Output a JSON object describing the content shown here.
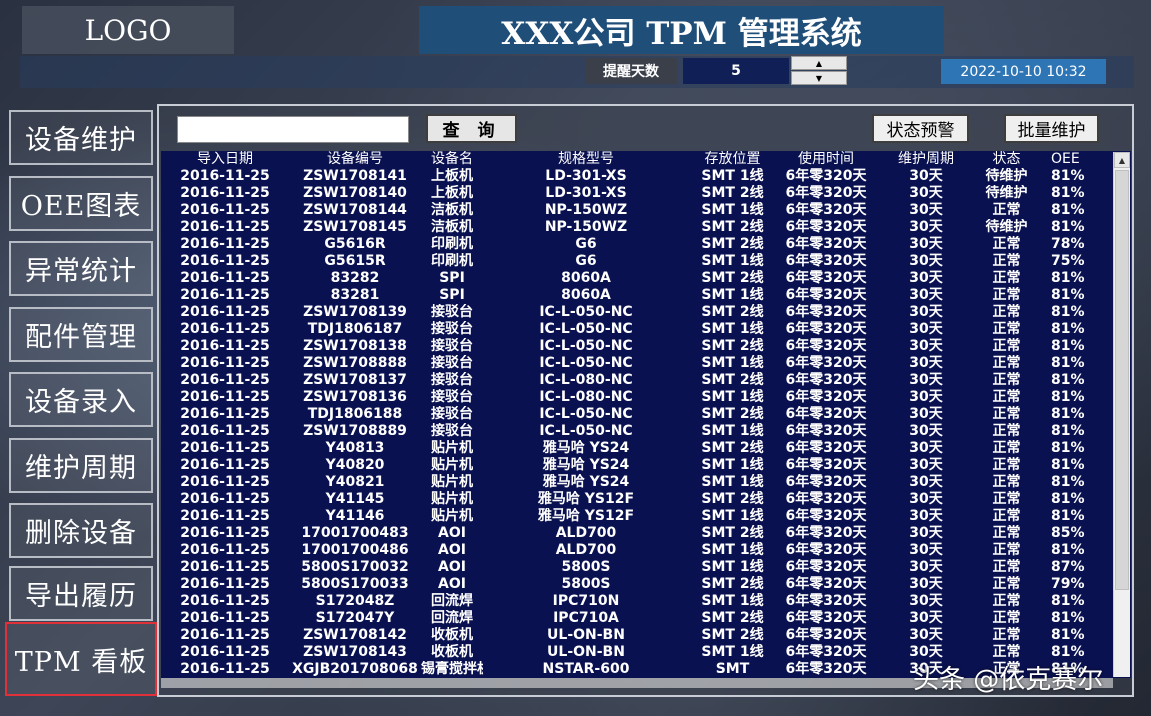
{
  "header": {
    "logo": "LOGO",
    "title": "XXX公司 TPM 管理系统",
    "remind_label": "提醒天数",
    "remind_value": "5",
    "datetime": "2022-10-10 10:32"
  },
  "sidebar": {
    "items": [
      {
        "label": "设备维护"
      },
      {
        "label": "OEE图表"
      },
      {
        "label": "异常统计"
      },
      {
        "label": "配件管理"
      },
      {
        "label": "设备录入"
      },
      {
        "label": "维护周期"
      },
      {
        "label": "删除设备"
      },
      {
        "label": "导出履历"
      },
      {
        "label": "TPM 看板"
      }
    ],
    "active_index": 8
  },
  "toolbar": {
    "search_value": "",
    "query_label": "查 询",
    "status_alert_label": "状态预警",
    "batch_maint_label": "批量维护"
  },
  "table": {
    "columns": [
      "导入日期",
      "设备编号",
      "设备名",
      "规格型号",
      "存放位置",
      "使用时间",
      "维护周期",
      "状态",
      "OEE"
    ],
    "rows": [
      [
        "2016-11-25",
        "ZSW1708141",
        "上板机",
        "LD-301-XS",
        "SMT 1线",
        "6年零320天",
        "30天",
        "待维护",
        "81%"
      ],
      [
        "2016-11-25",
        "ZSW1708140",
        "上板机",
        "LD-301-XS",
        "SMT 2线",
        "6年零320天",
        "30天",
        "待维护",
        "81%"
      ],
      [
        "2016-11-25",
        "ZSW1708144",
        "洁板机",
        "NP-150WZ",
        "SMT 1线",
        "6年零320天",
        "30天",
        "正常",
        "81%"
      ],
      [
        "2016-11-25",
        "ZSW1708145",
        "洁板机",
        "NP-150WZ",
        "SMT 2线",
        "6年零320天",
        "30天",
        "待维护",
        "81%"
      ],
      [
        "2016-11-25",
        "G5616R",
        "印刷机",
        "G6",
        "SMT 2线",
        "6年零320天",
        "30天",
        "正常",
        "78%"
      ],
      [
        "2016-11-25",
        "G5615R",
        "印刷机",
        "G6",
        "SMT 1线",
        "6年零320天",
        "30天",
        "正常",
        "75%"
      ],
      [
        "2016-11-25",
        "83282",
        "SPI",
        "8060A",
        "SMT 2线",
        "6年零320天",
        "30天",
        "正常",
        "81%"
      ],
      [
        "2016-11-25",
        "83281",
        "SPI",
        "8060A",
        "SMT 1线",
        "6年零320天",
        "30天",
        "正常",
        "81%"
      ],
      [
        "2016-11-25",
        "ZSW1708139",
        "接驳台",
        "IC-L-050-NC",
        "SMT 2线",
        "6年零320天",
        "30天",
        "正常",
        "81%"
      ],
      [
        "2016-11-25",
        "TDJ1806187",
        "接驳台",
        "IC-L-050-NC",
        "SMT 1线",
        "6年零320天",
        "30天",
        "正常",
        "81%"
      ],
      [
        "2016-11-25",
        "ZSW1708138",
        "接驳台",
        "IC-L-050-NC",
        "SMT 2线",
        "6年零320天",
        "30天",
        "正常",
        "81%"
      ],
      [
        "2016-11-25",
        "ZSW1708888",
        "接驳台",
        "IC-L-050-NC",
        "SMT 1线",
        "6年零320天",
        "30天",
        "正常",
        "81%"
      ],
      [
        "2016-11-25",
        "ZSW1708137",
        "接驳台",
        "IC-L-080-NC",
        "SMT 2线",
        "6年零320天",
        "30天",
        "正常",
        "81%"
      ],
      [
        "2016-11-25",
        "ZSW1708136",
        "接驳台",
        "IC-L-080-NC",
        "SMT 1线",
        "6年零320天",
        "30天",
        "正常",
        "81%"
      ],
      [
        "2016-11-25",
        "TDJ1806188",
        "接驳台",
        "IC-L-050-NC",
        "SMT 2线",
        "6年零320天",
        "30天",
        "正常",
        "81%"
      ],
      [
        "2016-11-25",
        "ZSW1708889",
        "接驳台",
        "IC-L-050-NC",
        "SMT 1线",
        "6年零320天",
        "30天",
        "正常",
        "81%"
      ],
      [
        "2016-11-25",
        "Y40813",
        "贴片机",
        "雅马哈 YS24",
        "SMT 2线",
        "6年零320天",
        "30天",
        "正常",
        "81%"
      ],
      [
        "2016-11-25",
        "Y40820",
        "贴片机",
        "雅马哈 YS24",
        "SMT 1线",
        "6年零320天",
        "30天",
        "正常",
        "81%"
      ],
      [
        "2016-11-25",
        "Y40821",
        "贴片机",
        "雅马哈 YS24",
        "SMT 1线",
        "6年零320天",
        "30天",
        "正常",
        "81%"
      ],
      [
        "2016-11-25",
        "Y41145",
        "贴片机",
        "雅马哈 YS12F",
        "SMT 2线",
        "6年零320天",
        "30天",
        "正常",
        "81%"
      ],
      [
        "2016-11-25",
        "Y41146",
        "贴片机",
        "雅马哈 YS12F",
        "SMT 1线",
        "6年零320天",
        "30天",
        "正常",
        "81%"
      ],
      [
        "2016-11-25",
        "17001700483",
        "AOI",
        "ALD700",
        "SMT 2线",
        "6年零320天",
        "30天",
        "正常",
        "85%"
      ],
      [
        "2016-11-25",
        "17001700486",
        "AOI",
        "ALD700",
        "SMT 1线",
        "6年零320天",
        "30天",
        "正常",
        "81%"
      ],
      [
        "2016-11-25",
        "5800S170032",
        "AOI",
        "5800S",
        "SMT 1线",
        "6年零320天",
        "30天",
        "正常",
        "87%"
      ],
      [
        "2016-11-25",
        "5800S170033",
        "AOI",
        "5800S",
        "SMT 2线",
        "6年零320天",
        "30天",
        "正常",
        "79%"
      ],
      [
        "2016-11-25",
        "S172048Z",
        "回流焊",
        "IPC710N",
        "SMT 1线",
        "6年零320天",
        "30天",
        "正常",
        "81%"
      ],
      [
        "2016-11-25",
        "S172047Y",
        "回流焊",
        "IPC710A",
        "SMT 2线",
        "6年零320天",
        "30天",
        "正常",
        "81%"
      ],
      [
        "2016-11-25",
        "ZSW1708142",
        "收板机",
        "UL-ON-BN",
        "SMT 2线",
        "6年零320天",
        "30天",
        "正常",
        "81%"
      ],
      [
        "2016-11-25",
        "ZSW1708143",
        "收板机",
        "UL-ON-BN",
        "SMT 1线",
        "6年零320天",
        "30天",
        "正常",
        "81%"
      ],
      [
        "2016-11-25",
        "XGJB201708068",
        "锡膏搅拌机",
        "NSTAR-600",
        "SMT",
        "6年零320天",
        "30天",
        "正常",
        "81%"
      ]
    ]
  },
  "watermark": "头条 @依克赛尔"
}
